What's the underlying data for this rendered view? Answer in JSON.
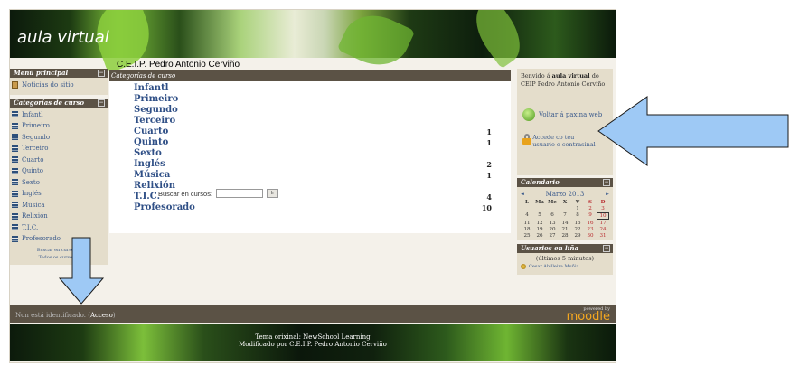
{
  "header": {
    "logo_text": "aula virtual",
    "school_name": "C.E.I.P. Pedro Antonio Cerviño"
  },
  "left": {
    "main_menu": {
      "title": "Menú principal",
      "items": [
        {
          "label": "Noticias do sitio",
          "icon": "news-icon"
        }
      ]
    },
    "categories": {
      "title": "Categorías de curso",
      "items": [
        {
          "label": "Infantl"
        },
        {
          "label": "Primeiro"
        },
        {
          "label": "Segundo"
        },
        {
          "label": "Terceiro"
        },
        {
          "label": "Cuarto"
        },
        {
          "label": "Quinto"
        },
        {
          "label": "Sexto"
        },
        {
          "label": "Inglés"
        },
        {
          "label": "Música"
        },
        {
          "label": "Relixión"
        },
        {
          "label": "T.I.C."
        },
        {
          "label": "Profesorado"
        }
      ],
      "search_link": "Buscar en cursos...",
      "all_courses_link": "Todos os cursos..."
    }
  },
  "center": {
    "title": "Categorías de curso",
    "rows": [
      {
        "name": "Infantl",
        "count": ""
      },
      {
        "name": "Primeiro",
        "count": ""
      },
      {
        "name": "Segundo",
        "count": ""
      },
      {
        "name": "Terceiro",
        "count": ""
      },
      {
        "name": "Cuarto",
        "count": "1"
      },
      {
        "name": "Quinto",
        "count": "1"
      },
      {
        "name": "Sexto",
        "count": ""
      },
      {
        "name": "Inglés",
        "count": "2"
      },
      {
        "name": "Música",
        "count": "1"
      },
      {
        "name": "Relixión",
        "count": ""
      },
      {
        "name": "T.I.C.",
        "count": "4"
      },
      {
        "name": "Profesorado",
        "count": "10"
      }
    ],
    "search_label": "Buscar en cursos:",
    "search_value": "",
    "search_button": "Ir"
  },
  "right": {
    "welcome_pre": "Benvido á",
    "welcome_bold": "aula virtual",
    "welcome_post": "do CEIP Pedro Antonio Cerviño",
    "home_link": "Voltar á paxina web",
    "login_link": "Accede co teu usuario e contrasinal",
    "calendar": {
      "title": "Calendario",
      "month": "Marzo 2013",
      "prev": "◄",
      "next": "►",
      "weekdays": [
        "L",
        "Ma",
        "Me",
        "X",
        "V",
        "S",
        "D"
      ],
      "weeks": [
        [
          "",
          "",
          "",
          "",
          "1",
          "2",
          "3"
        ],
        [
          "4",
          "5",
          "6",
          "7",
          "8",
          "9",
          "10"
        ],
        [
          "11",
          "12",
          "13",
          "14",
          "15",
          "16",
          "17"
        ],
        [
          "18",
          "19",
          "20",
          "21",
          "22",
          "23",
          "24"
        ],
        [
          "25",
          "26",
          "27",
          "28",
          "29",
          "30",
          "31"
        ]
      ],
      "today": "10"
    },
    "online": {
      "title": "Usuarios en liña",
      "minutes": "(últimos 5 minutos)",
      "user": "Cesar Abilleira Muñiz"
    }
  },
  "bottom": {
    "not_logged": "Non está identificado.",
    "login_link": "Acceso",
    "powered_by": "powered by",
    "moodle": "moodle",
    "theme_line": "Tema orixinal: NewSchool Learning",
    "modified_line": "Modificado por C.E.I.P. Pedro Antonio Cerviño"
  },
  "colors": {
    "block_header": "#5b5245",
    "block_body": "#e4ddcb",
    "link": "#3a5a8c",
    "arrow_fill": "#9ec9f5",
    "arrow_stroke": "#1a1a1a"
  }
}
